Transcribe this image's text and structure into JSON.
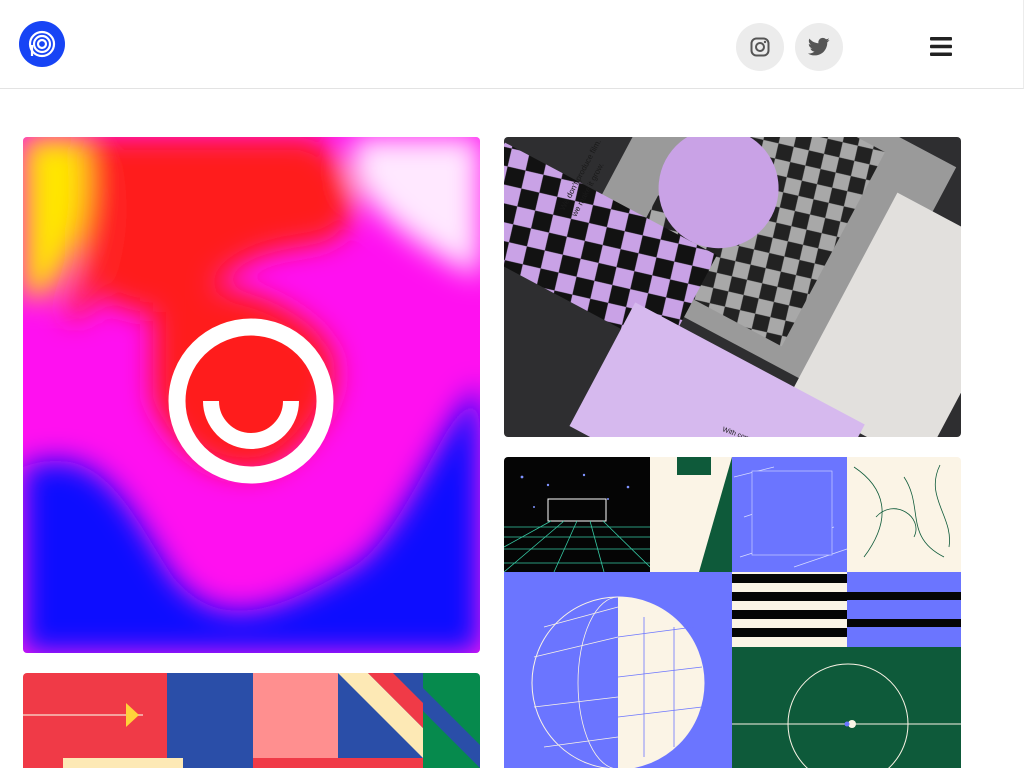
{
  "site": {
    "logo_icon": "spiral-logo-icon",
    "brand_color": "#1744f5"
  },
  "header": {
    "social_links": [
      {
        "icon": "instagram-icon"
      },
      {
        "icon": "twitter-icon"
      }
    ],
    "menu_icon": "hamburger-menu-icon"
  },
  "portfolio": {
    "tiles": [
      {
        "subject": "gradient-logo-artwork",
        "colors": [
          "#ff00ff",
          "#0a0aff",
          "#ff1a1a",
          "#ffe600"
        ]
      },
      {
        "subject": "stationery-mockup"
      },
      {
        "subject": "geometric-pattern"
      },
      {
        "subject": "illustration-grid"
      }
    ],
    "stationery_text": {
      "tagline_line1": "We don't produce film.",
      "tagline_line2": "we make it grow.",
      "card_footer": "With compli..."
    }
  }
}
